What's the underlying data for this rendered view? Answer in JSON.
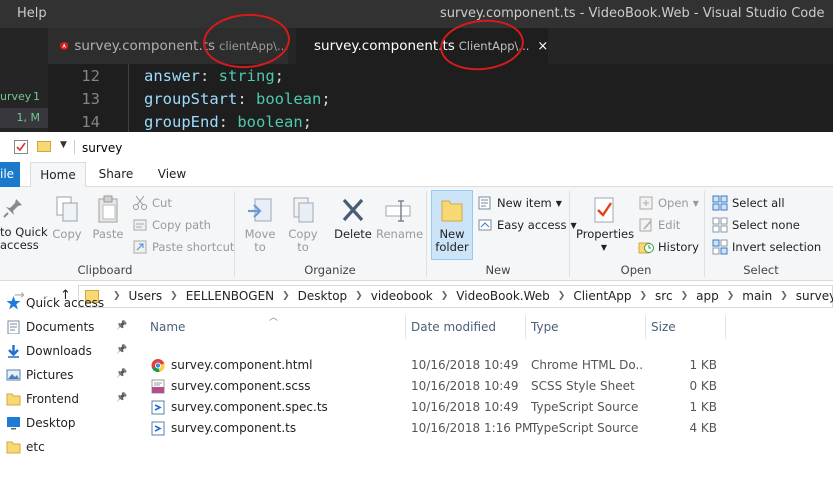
{
  "vscode": {
    "menu": "Help",
    "window_title": "survey.component.ts - VideoBook.Web - Visual Studio Code",
    "tabs": [
      {
        "filename": "survey.component.ts",
        "description": "clientApp\\...",
        "active": false
      },
      {
        "filename": "survey.component.ts",
        "description": "ClientApp\\...",
        "active": true
      }
    ],
    "close_glyph": "×",
    "sidebar_rows": [
      {
        "label": "urvey",
        "badge": "1"
      },
      {
        "label": "",
        "badge": "1, M"
      }
    ],
    "code_lines": [
      {
        "number": "12",
        "prop": "answer",
        "colon": ": ",
        "type": "string",
        "end": ";"
      },
      {
        "number": "13",
        "prop": "groupStart",
        "colon": ": ",
        "type": "boolean",
        "end": ";"
      },
      {
        "number": "14",
        "prop": "groupEnd",
        "colon": ": ",
        "type": "boolean",
        "end": ";"
      }
    ]
  },
  "explorer": {
    "title": "survey",
    "ribbon_tabs": {
      "file": "ile",
      "home": "Home",
      "share": "Share",
      "view": "View"
    },
    "clipboard": {
      "pin": "to Quick\naccess",
      "copy": "Copy",
      "paste": "Paste",
      "cut": "Cut",
      "copy_path": "Copy path",
      "paste_shortcut": "Paste shortcut",
      "label": "Clipboard"
    },
    "organize": {
      "move_to": "Move\nto",
      "copy_to": "Copy\nto",
      "delete": "Delete",
      "rename": "Rename",
      "label": "Organize"
    },
    "new": {
      "new_folder": "New\nfolder",
      "new_item": "New item",
      "easy_access": "Easy access",
      "label": "New"
    },
    "open": {
      "properties": "Properties",
      "open": "Open",
      "edit": "Edit",
      "history": "History",
      "label": "Open"
    },
    "select": {
      "select_all": "Select all",
      "select_none": "Select none",
      "invert_selection": "Invert selection",
      "label": "Select"
    },
    "address": {
      "crumbs": [
        "Users",
        "EELLENBOGEN",
        "Desktop",
        "videobook",
        "VideoBook.Web",
        "ClientApp",
        "src",
        "app",
        "main",
        "survey"
      ]
    },
    "nav_pane": [
      {
        "label": "Quick access",
        "icon": "star-icon",
        "pinned": false
      },
      {
        "label": "Documents",
        "icon": "documents-icon",
        "pinned": true
      },
      {
        "label": "Downloads",
        "icon": "downloads-icon",
        "pinned": true
      },
      {
        "label": "Pictures",
        "icon": "pictures-icon",
        "pinned": true
      },
      {
        "label": "Frontend",
        "icon": "folder-icon",
        "pinned": true
      },
      {
        "label": "Desktop",
        "icon": "desktop-icon",
        "pinned": false
      },
      {
        "label": "etc",
        "icon": "folder-icon",
        "pinned": false
      }
    ],
    "columns": {
      "name": "Name",
      "date": "Date modified",
      "type": "Type",
      "size": "Size"
    },
    "files": [
      {
        "name": "survey.component.html",
        "date": "10/16/2018 10:49",
        "type": "Chrome HTML Do...",
        "size": "1 KB",
        "icon": "chrome-icon"
      },
      {
        "name": "survey.component.scss",
        "date": "10/16/2018 10:49",
        "type": "SCSS Style Sheet",
        "size": "0 KB",
        "icon": "scss-file-icon"
      },
      {
        "name": "survey.component.spec.ts",
        "date": "10/16/2018 10:49",
        "type": "TypeScript Source ...",
        "size": "1 KB",
        "icon": "ts-file-icon"
      },
      {
        "name": "survey.component.ts",
        "date": "10/16/2018 1:16 PM",
        "type": "TypeScript Source ...",
        "size": "4 KB",
        "icon": "ts-file-icon"
      }
    ]
  }
}
